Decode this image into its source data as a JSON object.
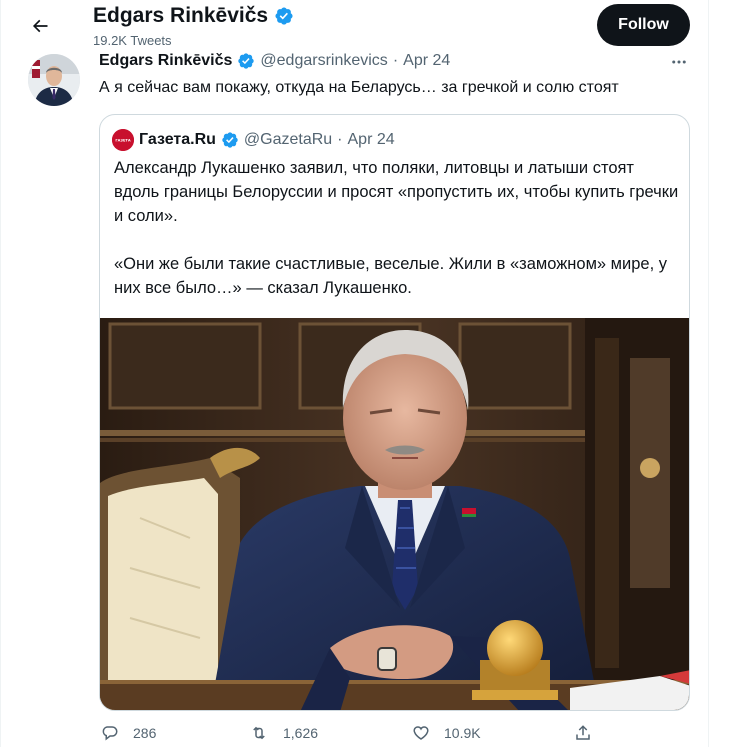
{
  "header": {
    "back_icon": "arrow-left-icon",
    "name": "Edgars Rinkēvičs",
    "tweet_count": "19.2K Tweets",
    "follow_label": "Follow"
  },
  "tweet": {
    "author_name": "Edgars Rinkēvičs",
    "handle": "@edgarsrinkevics",
    "separator": "·",
    "date": "Apr 24",
    "more_icon": "more-horizontal-icon",
    "text": "А я сейчас вам покажу, откуда на Беларусь… за гречкой и солю стоят"
  },
  "quoted": {
    "logo_text": "ГАЗЕТА",
    "author_name": "Газета.Ru",
    "handle": "@GazetaRu",
    "separator": "·",
    "date": "Apr 24",
    "paragraph_1": "Александр Лукашенко заявил, что поляки, литовцы и латыши стоят вдоль границы Белоруссии и просят «пропустить их, чтобы купить гречки и соли».",
    "paragraph_2": "«Они же были такие счастливые, веселые. Жили в «заможном» мире, у них все было…» — сказал Лукашенко."
  },
  "actions": {
    "reply_count": "286",
    "retweet_count": "1,626",
    "like_count": "10.9K"
  },
  "colors": {
    "text_primary": "#0f1419",
    "text_secondary": "#536471",
    "verified_blue": "#1d9bf0",
    "border": "#cfd9de",
    "follow_bg": "#0f1419"
  }
}
